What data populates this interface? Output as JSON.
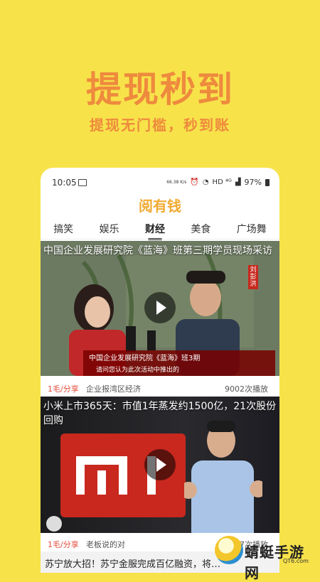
{
  "promo": {
    "title": "提现秒到",
    "subtitle": "提现无门槛，秒到账"
  },
  "statusbar": {
    "time": "10:05",
    "speed": "66.38\nK/s",
    "network": "HD ⁴ᴳ",
    "battery": "97%"
  },
  "app": {
    "title": "阅有钱"
  },
  "tabs": [
    "搞笑",
    "娱乐",
    "财经",
    "美食",
    "广场舞"
  ],
  "active_tab": "财经",
  "feed": [
    {
      "title": "中国企业发展研究院《蓝海》班第三期学员现场采访",
      "overlay_line1": "中国企业发展研究院《蓝海》班3期",
      "overlay_line2": "请问您认为此次活动中推出的",
      "name_tag": "刘彭洪",
      "share": "1毛/分享",
      "source": "企业报湾区经济",
      "plays": "9002次播放"
    },
    {
      "title": "小米上市365天：市值1年蒸发约1500亿，21次股份回购",
      "share": "1毛/分享",
      "source": "老板说的对",
      "plays": "8427次播放"
    },
    {
      "title": "苏宁放大招！苏宁金服完成百亿融资，将…"
    }
  ],
  "watermark": {
    "text": "蜻蜓手游网",
    "url": "QT6.com"
  },
  "colors": {
    "background": "#f7e24a",
    "promo_text": "#ee8a3d",
    "app_title": "#f0aa32",
    "share_red": "#e44b3a"
  }
}
